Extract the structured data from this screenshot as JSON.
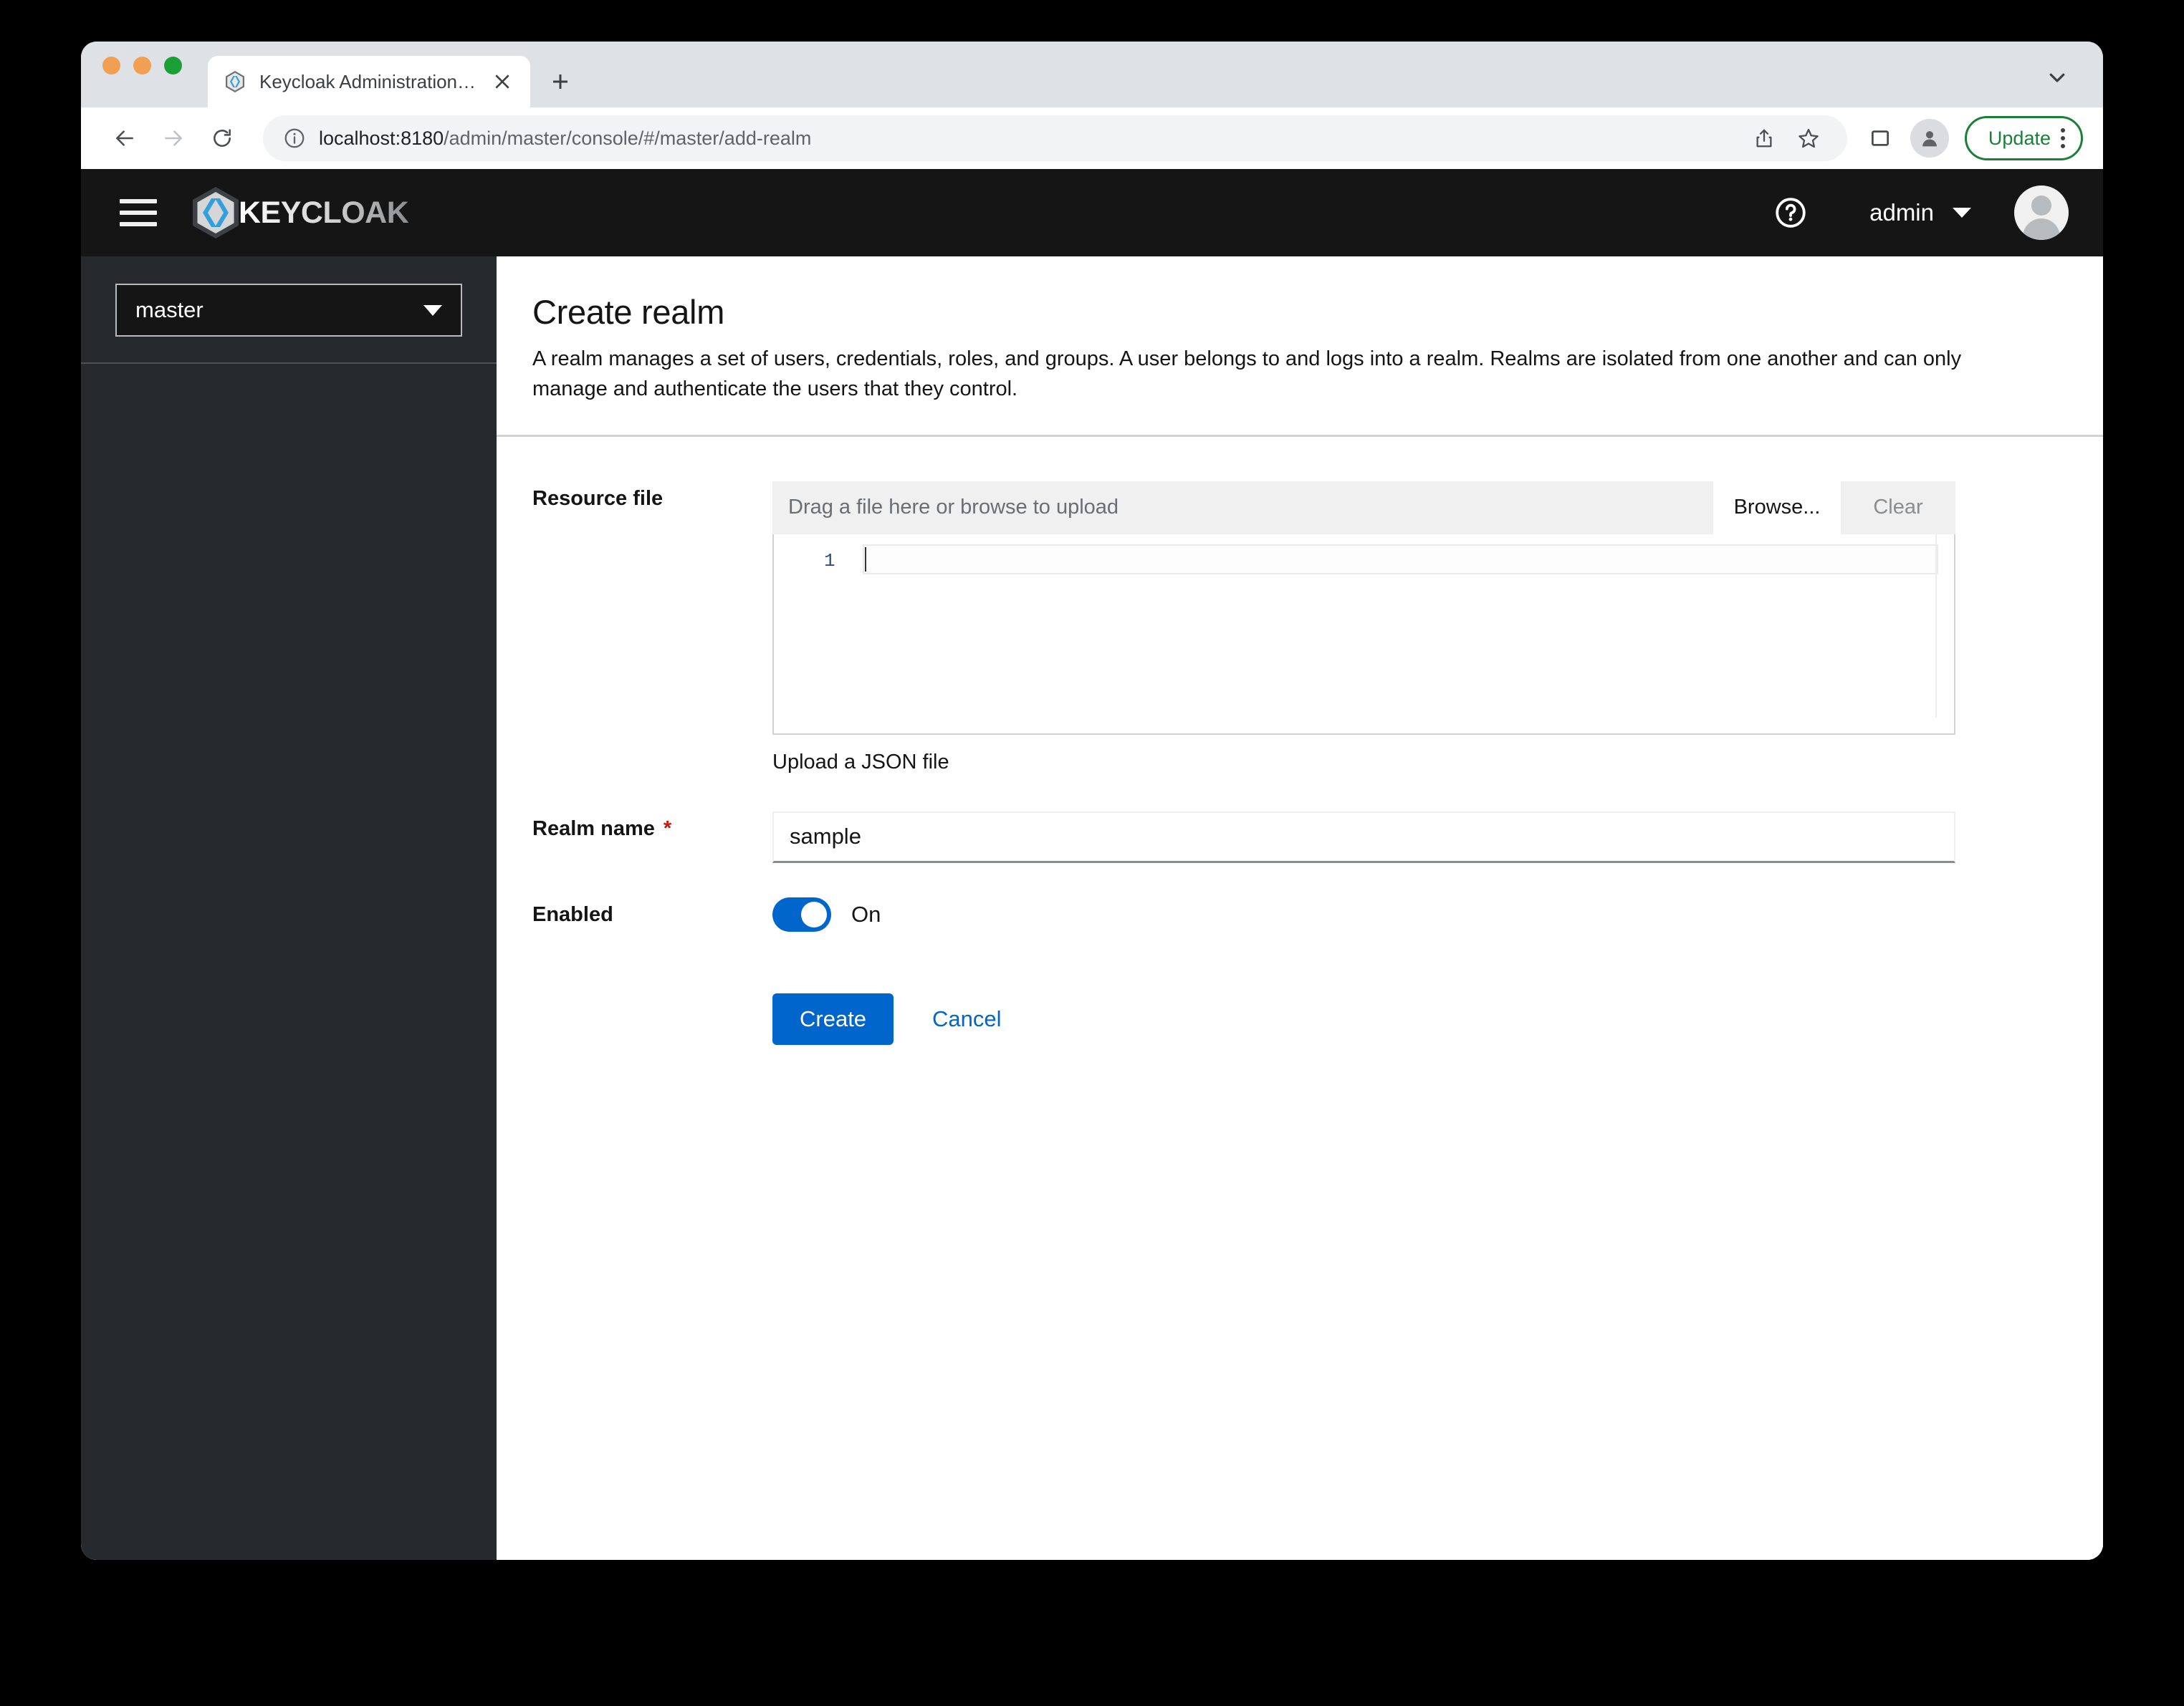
{
  "browser": {
    "tab": {
      "title": "Keycloak Administration UI",
      "favicon": "keycloak-favicon",
      "close_label": "×"
    },
    "new_tab_label": "+",
    "toolbar": {
      "back_label": "←",
      "forward_label": "→",
      "reload_label": "⟳",
      "url_host": "localhost:8180",
      "url_path": "/admin/master/console/#/master/add-realm",
      "full_url": "localhost:8180/admin/master/console/#/master/add-realm",
      "update_label": "Update"
    }
  },
  "masthead": {
    "brand_text": "KEYCLOAK",
    "user_name": "admin"
  },
  "sidebar": {
    "realm_selector": {
      "value": "master"
    }
  },
  "main": {
    "title": "Create realm",
    "description": "A realm manages a set of users, credentials, roles, and groups. A user belongs to and logs into a realm. Realms are isolated from one another and can only manage and authenticate the users that they control.",
    "form": {
      "resource_file": {
        "label": "Resource file",
        "drop_placeholder": "Drag a file here or browse to upload",
        "browse_label": "Browse...",
        "clear_label": "Clear",
        "editor_line_number": "1",
        "editor_value": "",
        "helper_text": "Upload a JSON file"
      },
      "realm_name": {
        "label": "Realm name",
        "required_marker": "*",
        "value": "sample",
        "placeholder": ""
      },
      "enabled": {
        "label": "Enabled",
        "state_label": "On",
        "checked": true
      },
      "submit_label": "Create",
      "cancel_label": "Cancel"
    }
  },
  "colors": {
    "accent_blue": "#0066cc",
    "masthead_bg": "#151515",
    "sidebar_bg": "#26292d",
    "required_red": "#c9190b",
    "update_green": "#1a8038"
  }
}
